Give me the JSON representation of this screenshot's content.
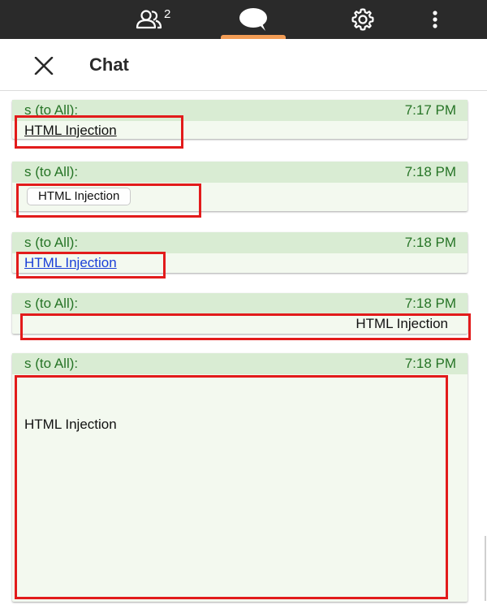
{
  "topbar": {
    "participants_count": "2",
    "active_tab": "chat",
    "accent_color": "#f29c55",
    "background_color": "#2a2a2a",
    "icons": [
      "people-icon",
      "chat-icon",
      "gear-icon",
      "more-vertical-icon"
    ]
  },
  "header": {
    "title": "Chat",
    "close_icon": "close-icon"
  },
  "messages": [
    {
      "sender": "s (to All):",
      "time": "7:17 PM",
      "content": "HTML Injection",
      "style": "underlined-text"
    },
    {
      "sender": "s (to All):",
      "time": "7:18 PM",
      "content": "HTML Injection",
      "style": "button"
    },
    {
      "sender": "s (to All):",
      "time": "7:18 PM",
      "content": "HTML Injection",
      "style": "blue-link"
    },
    {
      "sender": "s (to All):",
      "time": "7:18 PM",
      "content": "HTML Injection",
      "style": "right-aligned-text"
    },
    {
      "sender": "s (to All):",
      "time": "7:18 PM",
      "content": "HTML Injection",
      "style": "large-block"
    }
  ],
  "highlight_color": "#e21b1b",
  "message_header_color": "#d9ecd3",
  "message_text_color": "#267426"
}
